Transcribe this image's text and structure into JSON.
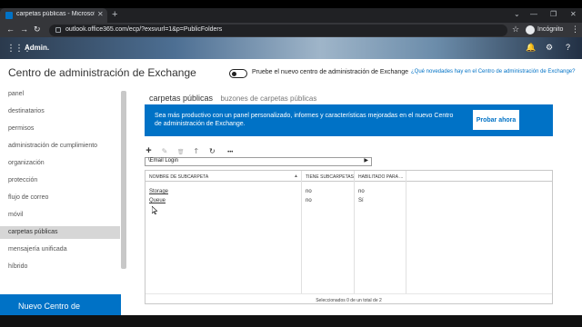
{
  "browser": {
    "tab_title": "carpetas públicas - Microsoft Exchange",
    "tab_close": "✕",
    "new_tab": "+",
    "win_minimize": "—",
    "win_restore": "❐",
    "win_close": "✕",
    "win_dropdown": "⌄",
    "back": "←",
    "forward": "→",
    "reload": "↻",
    "url": "outlook.office365.com/ecp/?exsvurl=1&p=PublicFolders",
    "star": "☆",
    "incognito_label": "Incógnito",
    "menu": "⋮"
  },
  "office_bar": {
    "waffle": "⋮⋮⋮",
    "admin_label": "Admin.",
    "bell": "🔔",
    "gear": "⚙",
    "help": "?"
  },
  "header": {
    "title": "Centro de administración de Exchange",
    "toggle_label": "Pruebe el nuevo centro de administración de Exchange",
    "whats_new": "¿Qué novedades hay en el Centro de administración de Exchange?"
  },
  "sidebar": {
    "items": [
      {
        "label": "panel"
      },
      {
        "label": "destinatarios"
      },
      {
        "label": "permisos"
      },
      {
        "label": "administración de cumplimiento"
      },
      {
        "label": "organización"
      },
      {
        "label": "protección"
      },
      {
        "label": "flujo de correo"
      },
      {
        "label": "móvil"
      },
      {
        "label": "carpetas públicas"
      },
      {
        "label": "mensajería unificada"
      },
      {
        "label": "híbrido"
      }
    ],
    "selected_index": 8,
    "banner": "Nuevo Centro de"
  },
  "tabs": {
    "active": "carpetas públicas",
    "other": "buzones de carpetas públicas"
  },
  "promo": {
    "text": "Sea más productivo con un panel personalizado, informes y características mejoradas en el nuevo Centro de administración de Exchange.",
    "button": "Probar ahora"
  },
  "toolbar": {
    "add_icon": "+",
    "edit_icon": "✎",
    "delete_icon": "🗑",
    "up_icon": "🡑",
    "refresh_icon": "↻",
    "more_icon": "•••"
  },
  "path": {
    "value": "\\Email Login",
    "arrow": "▶"
  },
  "grid": {
    "columns": [
      "NOMBRE DE SUBCARPETA",
      "TIENE SUBCARPETAS",
      "HABILITADO PARA ..."
    ],
    "sort_indicator": "▲",
    "rows": [
      {
        "name": "Storage",
        "has_subfolders": "no",
        "enabled": "no"
      },
      {
        "name": "Queue",
        "has_subfolders": "no",
        "enabled": "Sí"
      }
    ],
    "footer": "Seleccionados 0 de un total de 2"
  },
  "colors": {
    "accent": "#0072c6",
    "selected_bg": "#d6d6d6",
    "chrome_dark": "#202124"
  }
}
